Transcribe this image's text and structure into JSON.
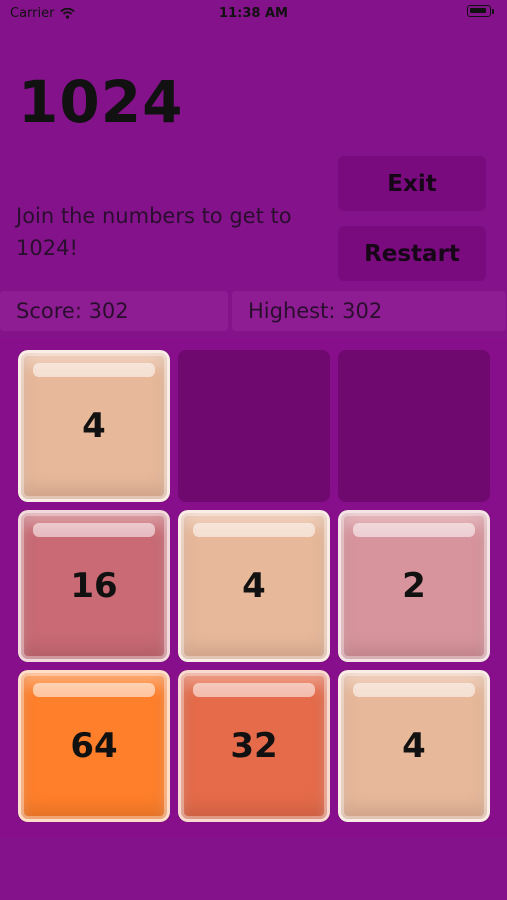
{
  "status_bar": {
    "carrier": "Carrier",
    "time": "11:38 AM"
  },
  "header": {
    "title": "1024",
    "subtitle": "Join the numbers to get to 1024!",
    "exit_label": "Exit",
    "restart_label": "Restart"
  },
  "scores": {
    "score": "Score: 302",
    "highest": "Highest: 302"
  },
  "board": {
    "rows": 3,
    "cols": 3,
    "tiles": [
      {
        "row": 0,
        "col": 0,
        "value": "4",
        "color": "#e8b89a"
      },
      {
        "row": 1,
        "col": 0,
        "value": "16",
        "color": "#c96a74"
      },
      {
        "row": 1,
        "col": 1,
        "value": "4",
        "color": "#e8b89a"
      },
      {
        "row": 1,
        "col": 2,
        "value": "2",
        "color": "#d8949c"
      },
      {
        "row": 2,
        "col": 0,
        "value": "64",
        "color": "#ff7f2a"
      },
      {
        "row": 2,
        "col": 1,
        "value": "32",
        "color": "#e56b4a"
      },
      {
        "row": 2,
        "col": 2,
        "value": "4",
        "color": "#e8b89a"
      }
    ],
    "empty_color": "#6f096f"
  },
  "colors": {
    "background": "#84128a",
    "button": "#7a0b7e",
    "score_box": "#8e1d93"
  }
}
